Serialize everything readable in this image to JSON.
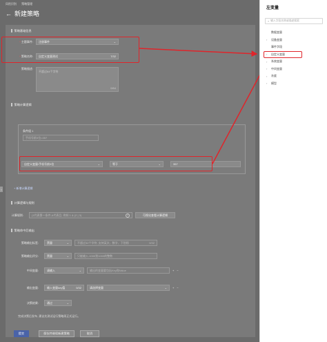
{
  "breadcrumb": {
    "items": [
      "风险识别",
      "策略管理"
    ]
  },
  "page": {
    "title": "新建策略",
    "back_icon": "arrow-left-icon"
  },
  "sections": {
    "basic": "策略基础信息",
    "logic": "策略计算逻辑",
    "calc": "计算逻辑与规则",
    "output": "策略命中后输出"
  },
  "form": {
    "event_label": "主题事件:",
    "event_value": "注册事件",
    "name_label": "策略名称:",
    "name_value": "自定义变量测试",
    "name_count": "7/32",
    "desc_label": "策略描述:",
    "desc_placeholder": "不超过64个字符",
    "desc_count": "0/64"
  },
  "condition": {
    "group_label": "条件组 1",
    "rule": "手机号前3位=357",
    "field": "自定义变量/手机号前3位",
    "operator": "等于",
    "value": "357",
    "add_link": "+ 新增计算逻辑"
  },
  "calc": {
    "label": "计算规则:",
    "placeholder": "(1代表第一条件,&代表且, 例如 1 & (2 | 3)",
    "button": "可视化查看计算逻辑"
  },
  "output": {
    "risk_label": "策略输出标签:",
    "risk_value": "黑量",
    "risk_placeholder": "不超过32个字符, 支持英文、数字、下划线",
    "risk_count": "0/32",
    "score_label": "策略输出评分:",
    "score_value": "黑量",
    "score_placeholder": "只能输入-1000到1000的整数",
    "mid_label": "中间变量:",
    "mid_value": "请输入",
    "mid_placeholder": "输出的变量要包括Key和Value",
    "out_label": "输出变量:",
    "out_value": "输入变量key值",
    "out_count": "0/32",
    "out_select": "请选择变量",
    "decision_label": "决策结果:",
    "decision_value": "通过",
    "tip": "完成决策后发布, 建议先测试运行策略再正式运行。"
  },
  "buttons": {
    "submit": "提交",
    "save_new": "保存并继续新建策略",
    "cancel": "取消"
  },
  "sidebar": {
    "title": "左变量",
    "search_placeholder": "输入字段名称或描述搜索",
    "items": [
      {
        "label": "数据变量",
        "has_children": false
      },
      {
        "label": "设备变量",
        "has_children": true
      },
      {
        "label": "事件字段",
        "has_children": false
      },
      {
        "label": "自定义变量",
        "has_children": true
      },
      {
        "label": "系统变量",
        "has_children": true
      },
      {
        "label": "中间变量",
        "has_children": true
      },
      {
        "label": "灰度",
        "has_children": true
      },
      {
        "label": "模型",
        "has_children": true
      }
    ]
  },
  "colors": {
    "annotation": "#e0242a",
    "primary": "#4a63a8"
  }
}
